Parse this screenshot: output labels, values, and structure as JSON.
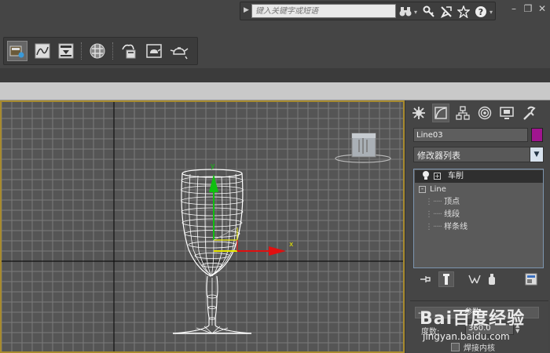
{
  "search": {
    "placeholder": "键入关键字或短语"
  },
  "titlebar": {
    "icons": [
      "binoculars-icon",
      "key-icon",
      "communication-center-icon",
      "favorites-star-icon",
      "help-icon"
    ],
    "window_controls": [
      "minimize",
      "restore",
      "close"
    ]
  },
  "toolbar": {
    "icons": [
      "scene-explorer-icon",
      "curve-editor-icon",
      "render-setup-icon",
      "material-editor-icon",
      "render-frame-icon",
      "render-teapot-icon",
      "quick-render-teapot-icon",
      "render-production-teapot-icon"
    ]
  },
  "viewport": {
    "axis_x_label": "x",
    "axis_y_label": "y",
    "object": "wine-glass-wireframe",
    "colors": {
      "grid": "#7a7a7a",
      "background": "#555555",
      "wireframe": "#ffffff",
      "x_axis": "#e01010",
      "y_axis": "#10c010",
      "border": "#a88b2e"
    }
  },
  "command_panel": {
    "tabs": [
      "create-icon",
      "modify-icon",
      "hierarchy-icon",
      "motion-icon",
      "display-icon",
      "utilities-icon"
    ],
    "object_name": "Line03",
    "object_color": "#a0158f",
    "modifier_list": "修改器列表",
    "stack": {
      "lathe": "车削",
      "line": "Line",
      "sub": [
        "顶点",
        "线段",
        "样条线"
      ]
    },
    "rollout": {
      "title": "参数",
      "degree_label": "度数:",
      "degree_value": "360.0",
      "weld_core": "焊接内核"
    }
  },
  "watermark": {
    "logo": "Bai百度经验",
    "url": "jingyan.baidu.com"
  }
}
